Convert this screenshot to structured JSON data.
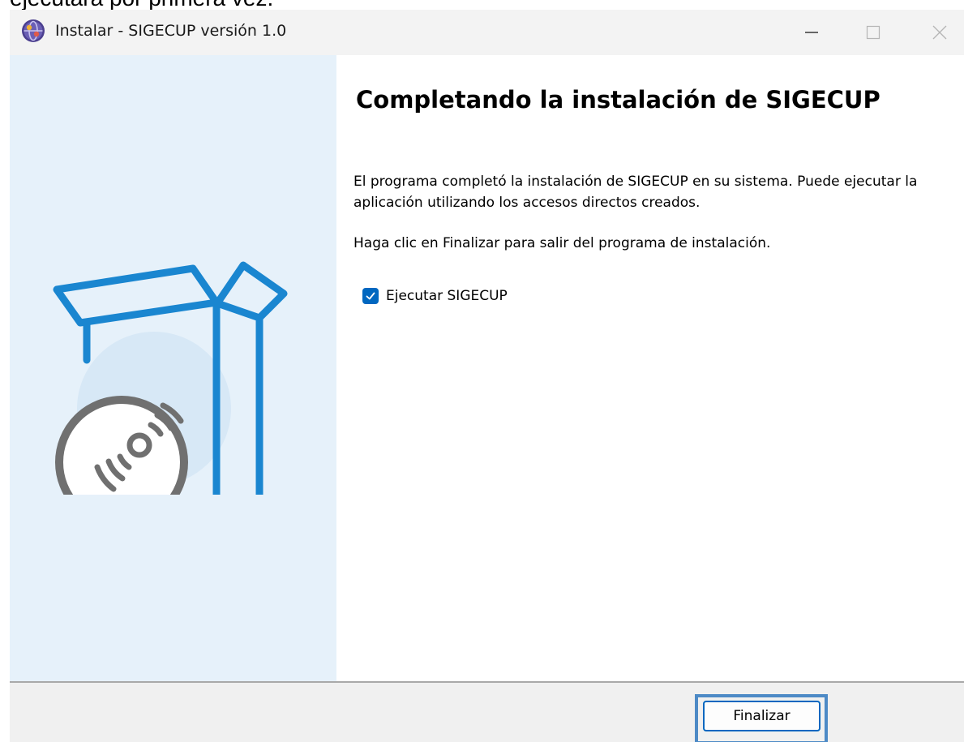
{
  "background_caption": "ejecutará por primera vez.",
  "window": {
    "title": "Instalar - SIGECUP versión 1.0",
    "app_icon": "setup-globe-icon",
    "controls": [
      "minimize-icon",
      "maximize-icon",
      "close-icon"
    ]
  },
  "sidebar": {
    "illustration": "box-with-disc-illustration",
    "colors": {
      "background": "#e6f1fa",
      "box": "#1a86d0",
      "disc": "#707070"
    }
  },
  "content": {
    "heading": "Completando la instalación de SIGECUP",
    "paragraph_1": "El programa completó la instalación de SIGECUP en su sistema. Puede ejecutar la aplicación utilizando los accesos directos creados.",
    "paragraph_2": "Haga clic en Finalizar para salir del programa de instalación.",
    "run_option": {
      "label": "Ejecutar SIGECUP",
      "checked": true
    }
  },
  "footer": {
    "finish_label": "Finalizar",
    "accent_color": "#0067c0"
  }
}
